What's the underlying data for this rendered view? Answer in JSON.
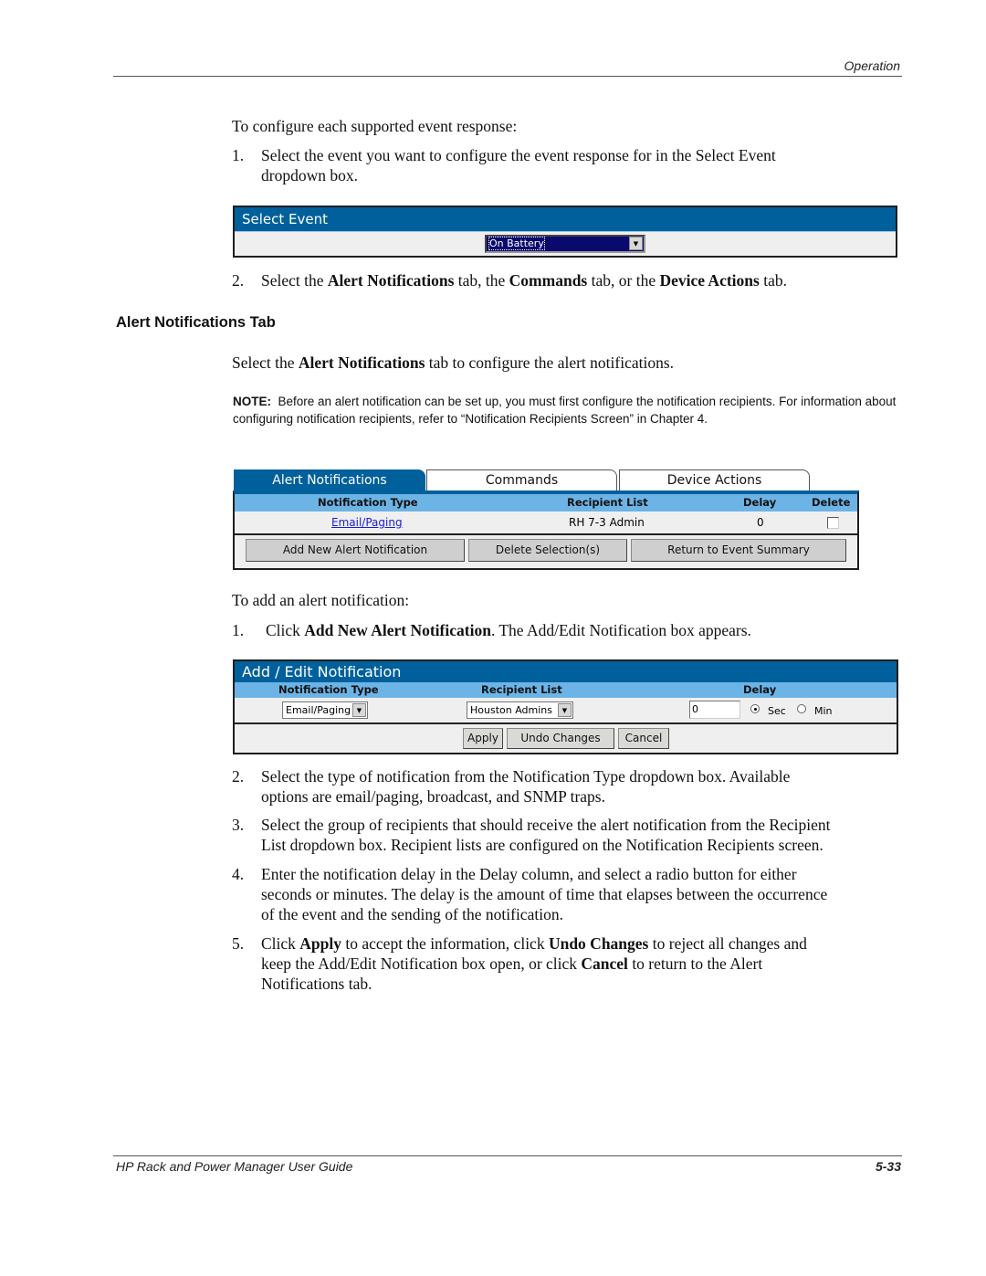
{
  "header": {
    "section": "Operation"
  },
  "intro": {
    "lead": "To configure each supported event response:",
    "step1_num": "1.",
    "step1_line1": "Select the event you want to configure the event response for in the Select Event",
    "step1_line2": "dropdown box.",
    "step2_num": "2.",
    "step2_parts": [
      "Select the ",
      "Alert Notifications",
      " tab, the ",
      "Commands",
      " tab, or the ",
      "Device Actions",
      " tab."
    ]
  },
  "select_event_panel": {
    "title": "Select Event",
    "dropdown_value": "On Battery"
  },
  "section_heading": "Alert Notifications Tab",
  "section_intro_parts": [
    "Select the ",
    "Alert Notifications",
    " tab to configure the alert notifications."
  ],
  "note": {
    "label": "NOTE:",
    "text": "Before an alert notification can be set up, you must first configure the notification recipients. For information about configuring notification recipients, refer to “Notification Recipients Screen” in Chapter 4."
  },
  "alert_panel": {
    "tabs": [
      {
        "label": "Alert Notifications",
        "active": true
      },
      {
        "label": "Commands",
        "active": false
      },
      {
        "label": "Device Actions",
        "active": false
      }
    ],
    "columns": [
      "Notification Type",
      "Recipient List",
      "Delay",
      "Delete"
    ],
    "rows": [
      {
        "type": "Email/Paging",
        "recipient_list": "RH 7-3 Admin",
        "delay": "0",
        "delete_checked": false
      }
    ],
    "buttons": [
      "Add New Alert Notification",
      "Delete Selection(s)",
      "Return to Event Summary"
    ]
  },
  "add_steps": {
    "lead": "To add an alert notification:",
    "step1_num": "1.",
    "step1_parts": [
      "Click ",
      "Add New Alert Notification",
      ". The Add/Edit Notification box appears."
    ]
  },
  "edit_panel": {
    "title": "Add / Edit Notification",
    "columns": [
      "Notification Type",
      "Recipient List",
      "Delay"
    ],
    "notification_type_value": "Email/Paging",
    "recipient_list_value": "Houston Admins",
    "delay_value": "0",
    "delay_units": [
      {
        "label": "Sec",
        "selected": true
      },
      {
        "label": "Min",
        "selected": false
      }
    ],
    "buttons": [
      "Apply",
      "Undo Changes",
      "Cancel"
    ]
  },
  "more_steps": [
    {
      "num": "2.",
      "lines": [
        "Select the type of notification from the Notification Type dropdown box. Available",
        "options are email/paging, broadcast, and SNMP traps."
      ]
    },
    {
      "num": "3.",
      "lines": [
        "Select the group of recipients that should receive the alert notification from the Recipient",
        "List dropdown box. Recipient lists are configured on the Notification Recipients screen."
      ]
    },
    {
      "num": "4.",
      "lines": [
        "Enter the notification delay in the Delay column, and select a radio button for either",
        "seconds or minutes. The delay is the amount of time that elapses between the occurrence",
        "of the event and the sending of the notification."
      ]
    }
  ],
  "step5": {
    "num": "5.",
    "line1_parts": [
      "Click ",
      "Apply",
      " to accept the information, click ",
      "Undo Changes",
      " to reject all changes and"
    ],
    "line2_parts": [
      "keep the Add/Edit Notification box open, or click ",
      "Cancel",
      " to return to the Alert"
    ],
    "line3": "Notifications tab."
  },
  "footer": {
    "guide_title": "HP Rack and Power Manager User Guide",
    "page_number": "5-33"
  },
  "colors": {
    "title_bar": "#00609c",
    "column_header": "#6db4e6",
    "panel_bg": "#efefef",
    "link": "#1a1adc"
  }
}
